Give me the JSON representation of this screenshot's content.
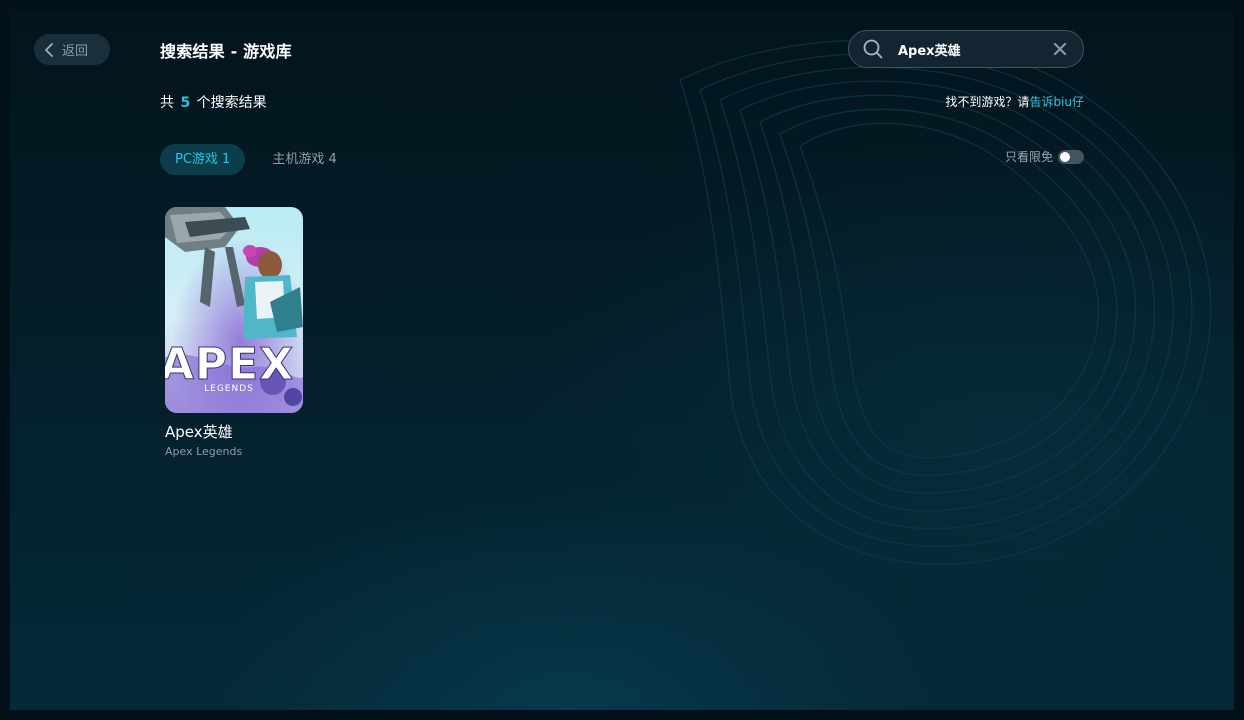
{
  "header": {
    "back_label": "返回",
    "title": "搜索结果 - 游戏库"
  },
  "search": {
    "value": "Apex英雄",
    "icon": "search-icon",
    "clear_icon": "close-icon"
  },
  "results": {
    "prefix": "共",
    "count": "5",
    "suffix": "个搜索结果"
  },
  "help": {
    "text": "找不到游戏？请",
    "link": "告诉biu仔"
  },
  "tabs": [
    {
      "label": "PC游戏 1",
      "active": true
    },
    {
      "label": "主机游戏 4",
      "active": false
    }
  ],
  "filter": {
    "label": "只看限免",
    "enabled": false
  },
  "games": [
    {
      "name": "Apex英雄",
      "subtitle": "Apex Legends",
      "cover_text": "APEX",
      "cover_subtext": "LEGENDS"
    }
  ],
  "colors": {
    "accent": "#2cc6e0",
    "background": "#021119"
  }
}
